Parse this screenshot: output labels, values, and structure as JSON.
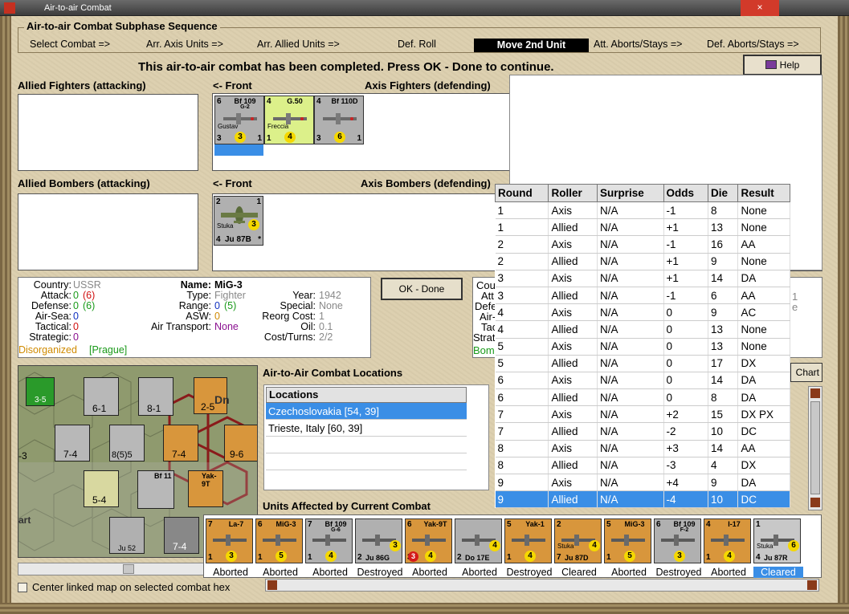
{
  "window": {
    "title": "Air-to-air Combat",
    "close": "×"
  },
  "phase": {
    "title": "Air-to-air Combat Subphase Sequence",
    "steps": [
      "Select Combat =>",
      "Arr. Axis Units =>",
      "Arr. Allied Units =>",
      "Def. Roll",
      "Move 2nd Unit",
      "Att. Aborts/Stays =>",
      "Def. Aborts/Stays =>"
    ],
    "active_step_index": 4
  },
  "status_message": "This air-to-air combat has been completed.  Press OK - Done to continue.",
  "help_label": "Help",
  "sections": {
    "allied_fighters": "Allied Fighters (attacking)",
    "front_1": "<- Front",
    "axis_fighters": "Axis Fighters (defending)",
    "allied_bombers": "Allied Bombers (attacking)",
    "front_2": "<- Front",
    "axis_bombers": "Axis Bombers (defending)"
  },
  "axis_fighters": [
    {
      "tl": "6",
      "name": "Bf 109",
      "sub": "G-2",
      "pilot": "Gustav",
      "bl": "3",
      "circle": "3",
      "br": "1",
      "color": "gray"
    },
    {
      "tl": "4",
      "name": "G.50",
      "sub": "",
      "pilot": "Freccia",
      "bl": "1",
      "circle": "4",
      "br": "",
      "color": "lime"
    },
    {
      "tl": "4",
      "name": "Bf 110D",
      "sub": "",
      "pilot": "",
      "bl": "3",
      "circle": "6",
      "br": "1",
      "color": "gray"
    }
  ],
  "axis_bombers": [
    {
      "tl": "2",
      "tr": "1",
      "pilot": "Stuka",
      "circle": "3",
      "bl": "4",
      "name": "Ju 87B",
      "br": "*"
    }
  ],
  "unit_info": {
    "country_l": "Country:",
    "country": "USSR",
    "attack_l": "Attack:",
    "attack": "0",
    "attack2": "(6)",
    "defense_l": "Defense:",
    "defense": "0",
    "defense2": "(6)",
    "airsea_l": "Air-Sea:",
    "airsea": "0",
    "tactical_l": "Tactical:",
    "tactical": "0",
    "strategic_l": "Strategic:",
    "strategic": "0",
    "disorg": "Disorganized",
    "prague": "[Prague]",
    "name_l": "Name:",
    "name": "MiG-3",
    "type_l": "Type:",
    "type": "Fighter",
    "range_l": "Range:",
    "range": "0",
    "range2": "(5)",
    "asw_l": "ASW:",
    "asw": "0",
    "airtrans_l": "Air Transport:",
    "airtrans": "None",
    "year_l": "Year:",
    "year": "1942",
    "special_l": "Special:",
    "special": "None",
    "reorg_l": "Reorg Cost:",
    "reorg": "1",
    "oil_l": "Oil:",
    "oil": "0.1",
    "cost_l": "Cost/Turns:",
    "cost": "2/2"
  },
  "ok_label": "OK - Done",
  "right_info": [
    "Cou",
    "Att",
    "Defe",
    "Air-",
    "Tac",
    "Strat",
    "Bomb"
  ],
  "right_info_tail": [
    "1",
    "e"
  ],
  "chart_btn": "Chart",
  "results": {
    "headers": [
      "Round",
      "Roller",
      "Surprise",
      "Odds",
      "Die",
      "Result"
    ],
    "rows": [
      [
        "1",
        "Axis",
        "N/A",
        "-1",
        "8",
        "None"
      ],
      [
        "1",
        "Allied",
        "N/A",
        "+1",
        "13",
        "None"
      ],
      [
        "2",
        "Axis",
        "N/A",
        "-1",
        "16",
        "AA"
      ],
      [
        "2",
        "Allied",
        "N/A",
        "+1",
        "9",
        "None"
      ],
      [
        "3",
        "Axis",
        "N/A",
        "+1",
        "14",
        "DA"
      ],
      [
        "3",
        "Allied",
        "N/A",
        "-1",
        "6",
        "AA"
      ],
      [
        "4",
        "Axis",
        "N/A",
        "0",
        "9",
        "AC"
      ],
      [
        "4",
        "Allied",
        "N/A",
        "0",
        "13",
        "None"
      ],
      [
        "5",
        "Axis",
        "N/A",
        "0",
        "13",
        "None"
      ],
      [
        "5",
        "Allied",
        "N/A",
        "0",
        "17",
        "DX"
      ],
      [
        "6",
        "Axis",
        "N/A",
        "0",
        "14",
        "DA"
      ],
      [
        "6",
        "Allied",
        "N/A",
        "0",
        "8",
        "DA"
      ],
      [
        "7",
        "Axis",
        "N/A",
        "+2",
        "15",
        "DX PX"
      ],
      [
        "7",
        "Allied",
        "N/A",
        "-2",
        "10",
        "DC"
      ],
      [
        "8",
        "Axis",
        "N/A",
        "+3",
        "14",
        "AA"
      ],
      [
        "8",
        "Allied",
        "N/A",
        "-3",
        "4",
        "DX"
      ],
      [
        "9",
        "Axis",
        "N/A",
        "+4",
        "9",
        "DA"
      ],
      [
        "9",
        "Allied",
        "N/A",
        "-4",
        "10",
        "DC"
      ]
    ],
    "selected_row": 17
  },
  "locations": {
    "title": "Air-to-Air Combat Locations",
    "header": "Locations",
    "rows": [
      "Czechoslovakia [54, 39]",
      "Trieste, Italy [60, 39]"
    ],
    "selected": 0
  },
  "units_affected": {
    "title": "Units Affected by Current Combat",
    "units": [
      {
        "tl": "7",
        "name": "La-7",
        "sub": "",
        "bl": "1",
        "circle": "3",
        "status": "Aborted",
        "color": "orange"
      },
      {
        "tl": "6",
        "name": "MiG-3",
        "sub": "",
        "bl": "1",
        "circle": "5",
        "status": "Aborted",
        "color": "orange"
      },
      {
        "tl": "7",
        "name": "Bf 109",
        "sub": "G-6",
        "bl": "1",
        "circle": "4",
        "status": "Aborted",
        "color": "gray"
      },
      {
        "tl": "",
        "name": "",
        "sub": "",
        "bl": "2",
        "circle": "3",
        "status": "Destroyed",
        "color": "gray",
        "bottom": "Ju 86G"
      },
      {
        "tl": "6",
        "name": "Yak-9T",
        "sub": "",
        "bl": "3",
        "circle": "4",
        "status": "Aborted",
        "color": "orange",
        "red": "3"
      },
      {
        "tl": "",
        "name": "",
        "sub": "",
        "bl": "2",
        "circle": "4",
        "status": "Aborted",
        "color": "gray",
        "bottom": "Do 17E"
      },
      {
        "tl": "5",
        "name": "Yak-1",
        "sub": "",
        "bl": "1",
        "circle": "4",
        "status": "Destroyed",
        "color": "orange"
      },
      {
        "tl": "2",
        "name": "",
        "sub": "",
        "bl": "7",
        "circle": "4",
        "status": "Cleared",
        "color": "orange",
        "bottom": "Ju 87D",
        "pilot": "Stuka"
      },
      {
        "tl": "5",
        "name": "MiG-3",
        "sub": "",
        "bl": "1",
        "circle": "5",
        "status": "Aborted",
        "color": "orange"
      },
      {
        "tl": "6",
        "name": "Bf 109",
        "sub": "F-2",
        "bl": "",
        "circle": "3",
        "status": "Destroyed",
        "color": "gray"
      },
      {
        "tl": "4",
        "name": "I-17",
        "sub": "",
        "bl": "1",
        "circle": "4",
        "status": "Aborted",
        "color": "orange"
      },
      {
        "tl": "1",
        "name": "",
        "sub": "",
        "bl": "4",
        "circle": "6",
        "status": "Cleared",
        "color": "lt",
        "bottom": "Ju 87R",
        "pilot": "Stuka"
      }
    ],
    "selected": 11
  },
  "center_map_label": "Center linked map on selected combat hex",
  "map_counters": [
    "3-5",
    "6-1",
    "8-1",
    "2-5",
    "7-4",
    "8(5)5",
    "7-4",
    "9-6",
    "5-4",
    "Bf 11",
    "Yak-9T",
    "7-4",
    "Ju 52",
    "Dn",
    "-3",
    "art"
  ],
  "colors": {
    "accent": "#3a8ee6",
    "active_step": "#000000",
    "red_val": "#d01010",
    "green_val": "#1a9a1a",
    "blue_val": "#1030c0",
    "orange_val": "#d08a00",
    "purple_val": "#8a1090"
  }
}
